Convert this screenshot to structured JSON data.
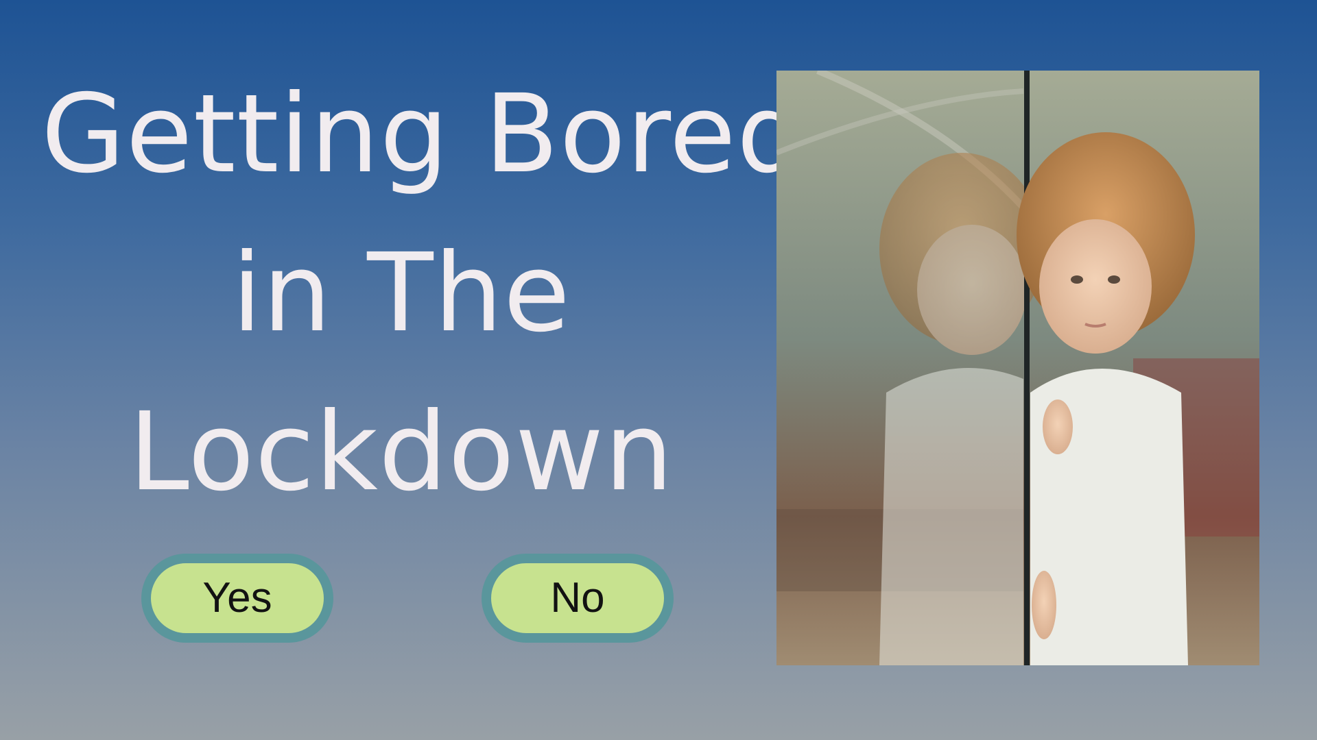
{
  "headline": {
    "line1": "Getting Bored",
    "line2": "in The",
    "line3": "Lockdown"
  },
  "buttons": {
    "yes_label": "Yes",
    "no_label": "No"
  },
  "colors": {
    "background_top": "#1e5394",
    "background_bottom": "#98a0a6",
    "headline_text": "#f1ecef",
    "button_fill": "#c7e28f",
    "button_border": "#5a969c",
    "button_text": "#121212"
  },
  "image": {
    "icon": "child-at-window-photo"
  }
}
